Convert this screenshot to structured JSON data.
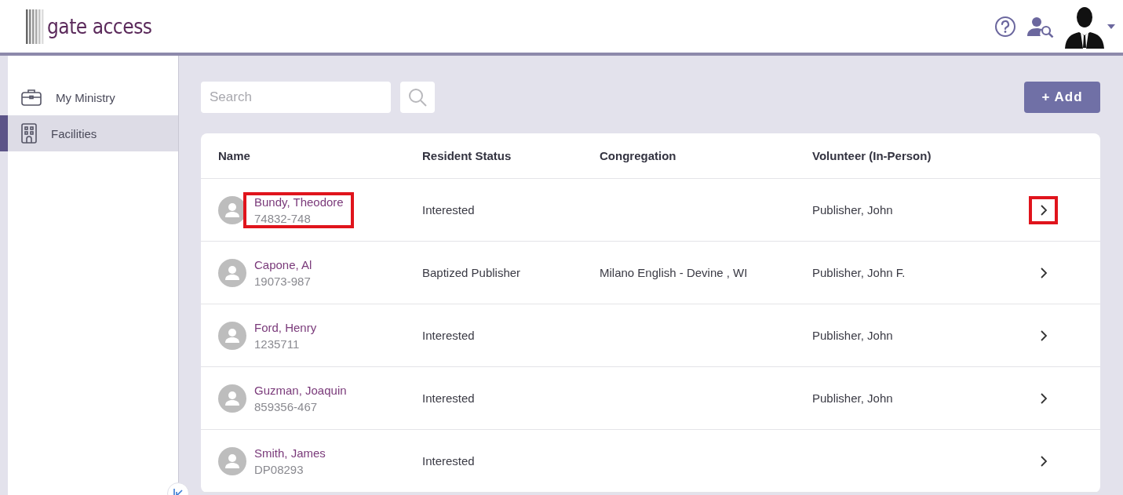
{
  "header": {
    "logo": "gate access"
  },
  "sidebar": {
    "items": [
      {
        "label": "My Ministry",
        "kind": "briefcase",
        "selected": false
      },
      {
        "label": "Facilities",
        "kind": "building",
        "selected": true
      }
    ]
  },
  "toolbar": {
    "search": {
      "placeholder": "Search"
    },
    "add_button": "+ Add"
  },
  "table": {
    "columns": [
      "Name",
      "Resident Status",
      "Congregation",
      "Volunteer (In-Person)"
    ],
    "rows": [
      {
        "name": "Bundy, Theodore",
        "id": "74832-748",
        "status": "Interested",
        "volunteer": "Publisher, John",
        "highlighted": true
      },
      {
        "name": "Capone, Al",
        "id": "19073-987",
        "status": "Baptized Publisher",
        "congregation": "Milano English - Devine , WI",
        "volunteer": "Publisher, John F.",
        "highlighted": false
      },
      {
        "name": "Ford, Henry",
        "id": "1235711",
        "status": "Interested",
        "volunteer": "Publisher, John",
        "highlighted": false
      },
      {
        "name": "Guzman, Joaquin",
        "id": "859356-467",
        "status": "Interested",
        "volunteer": "Publisher, John",
        "highlighted": false
      },
      {
        "name": "Smith, James",
        "id": "DP08293",
        "status": "Interested",
        "highlighted": false
      }
    ]
  }
}
